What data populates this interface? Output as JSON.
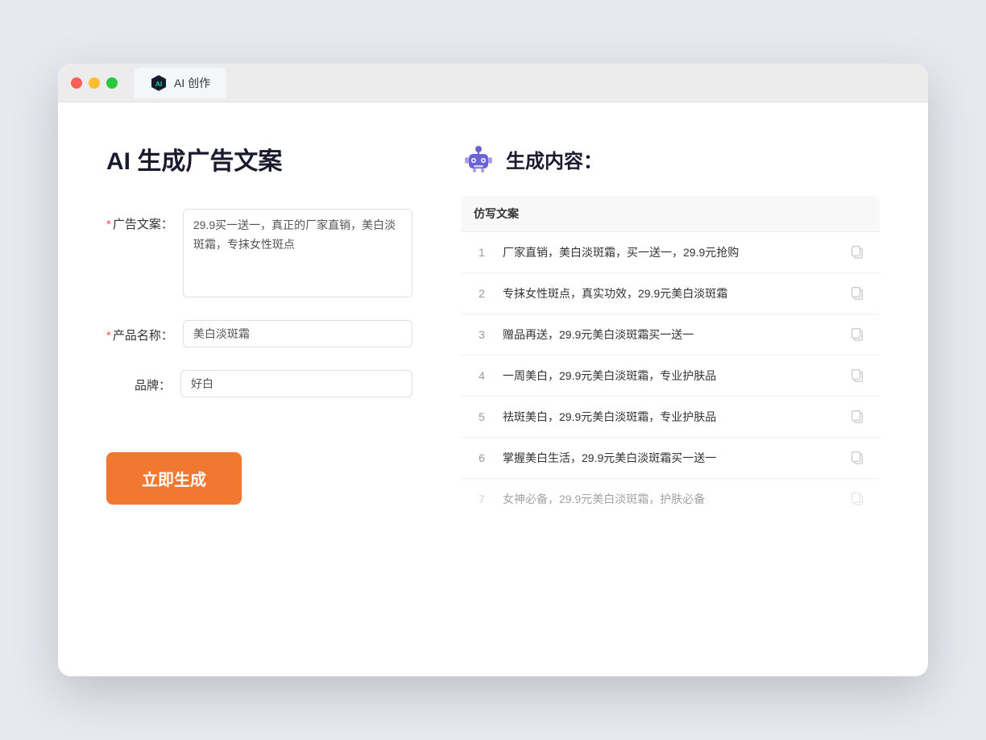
{
  "browser": {
    "tab_title": "AI 创作"
  },
  "page": {
    "title": "AI 生成广告文案",
    "form": {
      "ad_copy_label": "广告文案：",
      "ad_copy_required": "*",
      "ad_copy_value": "29.9买一送一，真正的厂家直销，美白淡斑霜，专抹女性斑点",
      "product_name_label": "产品名称：",
      "product_name_required": "*",
      "product_name_value": "美白淡斑霜",
      "brand_label": "品牌：",
      "brand_value": "好白",
      "generate_button": "立即生成"
    },
    "results": {
      "header_icon": "robot",
      "header_title": "生成内容：",
      "column_header": "仿写文案",
      "items": [
        {
          "num": 1,
          "text": "厂家直销，美白淡斑霜，买一送一，29.9元抢购",
          "dimmed": false
        },
        {
          "num": 2,
          "text": "专抹女性斑点，真实功效，29.9元美白淡斑霜",
          "dimmed": false
        },
        {
          "num": 3,
          "text": "赠品再送，29.9元美白淡斑霜买一送一",
          "dimmed": false
        },
        {
          "num": 4,
          "text": "一周美白，29.9元美白淡斑霜，专业护肤品",
          "dimmed": false
        },
        {
          "num": 5,
          "text": "祛斑美白，29.9元美白淡斑霜，专业护肤品",
          "dimmed": false
        },
        {
          "num": 6,
          "text": "掌握美白生活，29.9元美白淡斑霜买一送一",
          "dimmed": false
        },
        {
          "num": 7,
          "text": "女神必备，29.9元美白淡斑霜，护肤必备",
          "dimmed": true
        }
      ]
    }
  }
}
